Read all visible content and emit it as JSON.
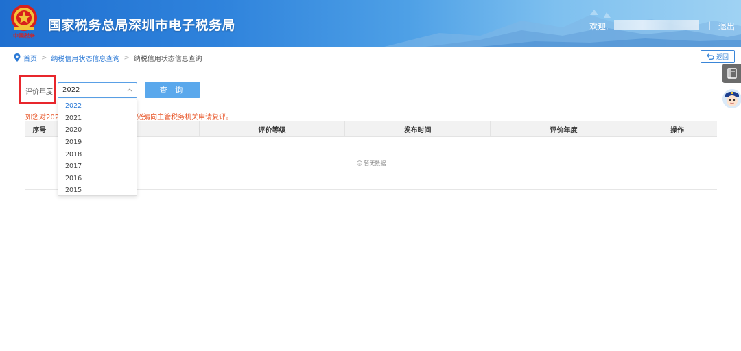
{
  "header": {
    "title": "国家税务总局深圳市电子税务局",
    "welcome": "欢迎,",
    "separator": "|",
    "logout": "退出",
    "emblem_text": "中国税务"
  },
  "breadcrumb": {
    "home": "首页",
    "level1": "纳税信用状态信息查询",
    "current": "纳税信用状态信息查询",
    "separator": ">"
  },
  "back_button": "返回",
  "form": {
    "year_label": "评价年度:",
    "selected_year": "2022",
    "query_button": "查 询",
    "year_options": [
      "2022",
      "2021",
      "2020",
      "2019",
      "2018",
      "2017",
      "2016",
      "2015"
    ]
  },
  "notice": {
    "part1": "如您对2022",
    "part2": "分",
    "part3": "议,请向主管税务机关申请复评。"
  },
  "table": {
    "columns": [
      "序号",
      "",
      "评价等级",
      "发布时间",
      "评价年度",
      "操作"
    ],
    "empty_text": "暂无数据"
  },
  "colors": {
    "header_blue": "#1f6fd0",
    "accent_blue": "#2c7ad6",
    "button_blue": "#5aa8ec",
    "highlight_red": "#e8262c",
    "notice_orange": "#e8572a"
  },
  "icons": {
    "location": "location-pin-icon",
    "back": "back-arrow-icon",
    "chevron": "chevron-up-icon",
    "book": "book-icon",
    "assistant": "assistant-avatar-icon",
    "empty": "empty-face-icon"
  }
}
